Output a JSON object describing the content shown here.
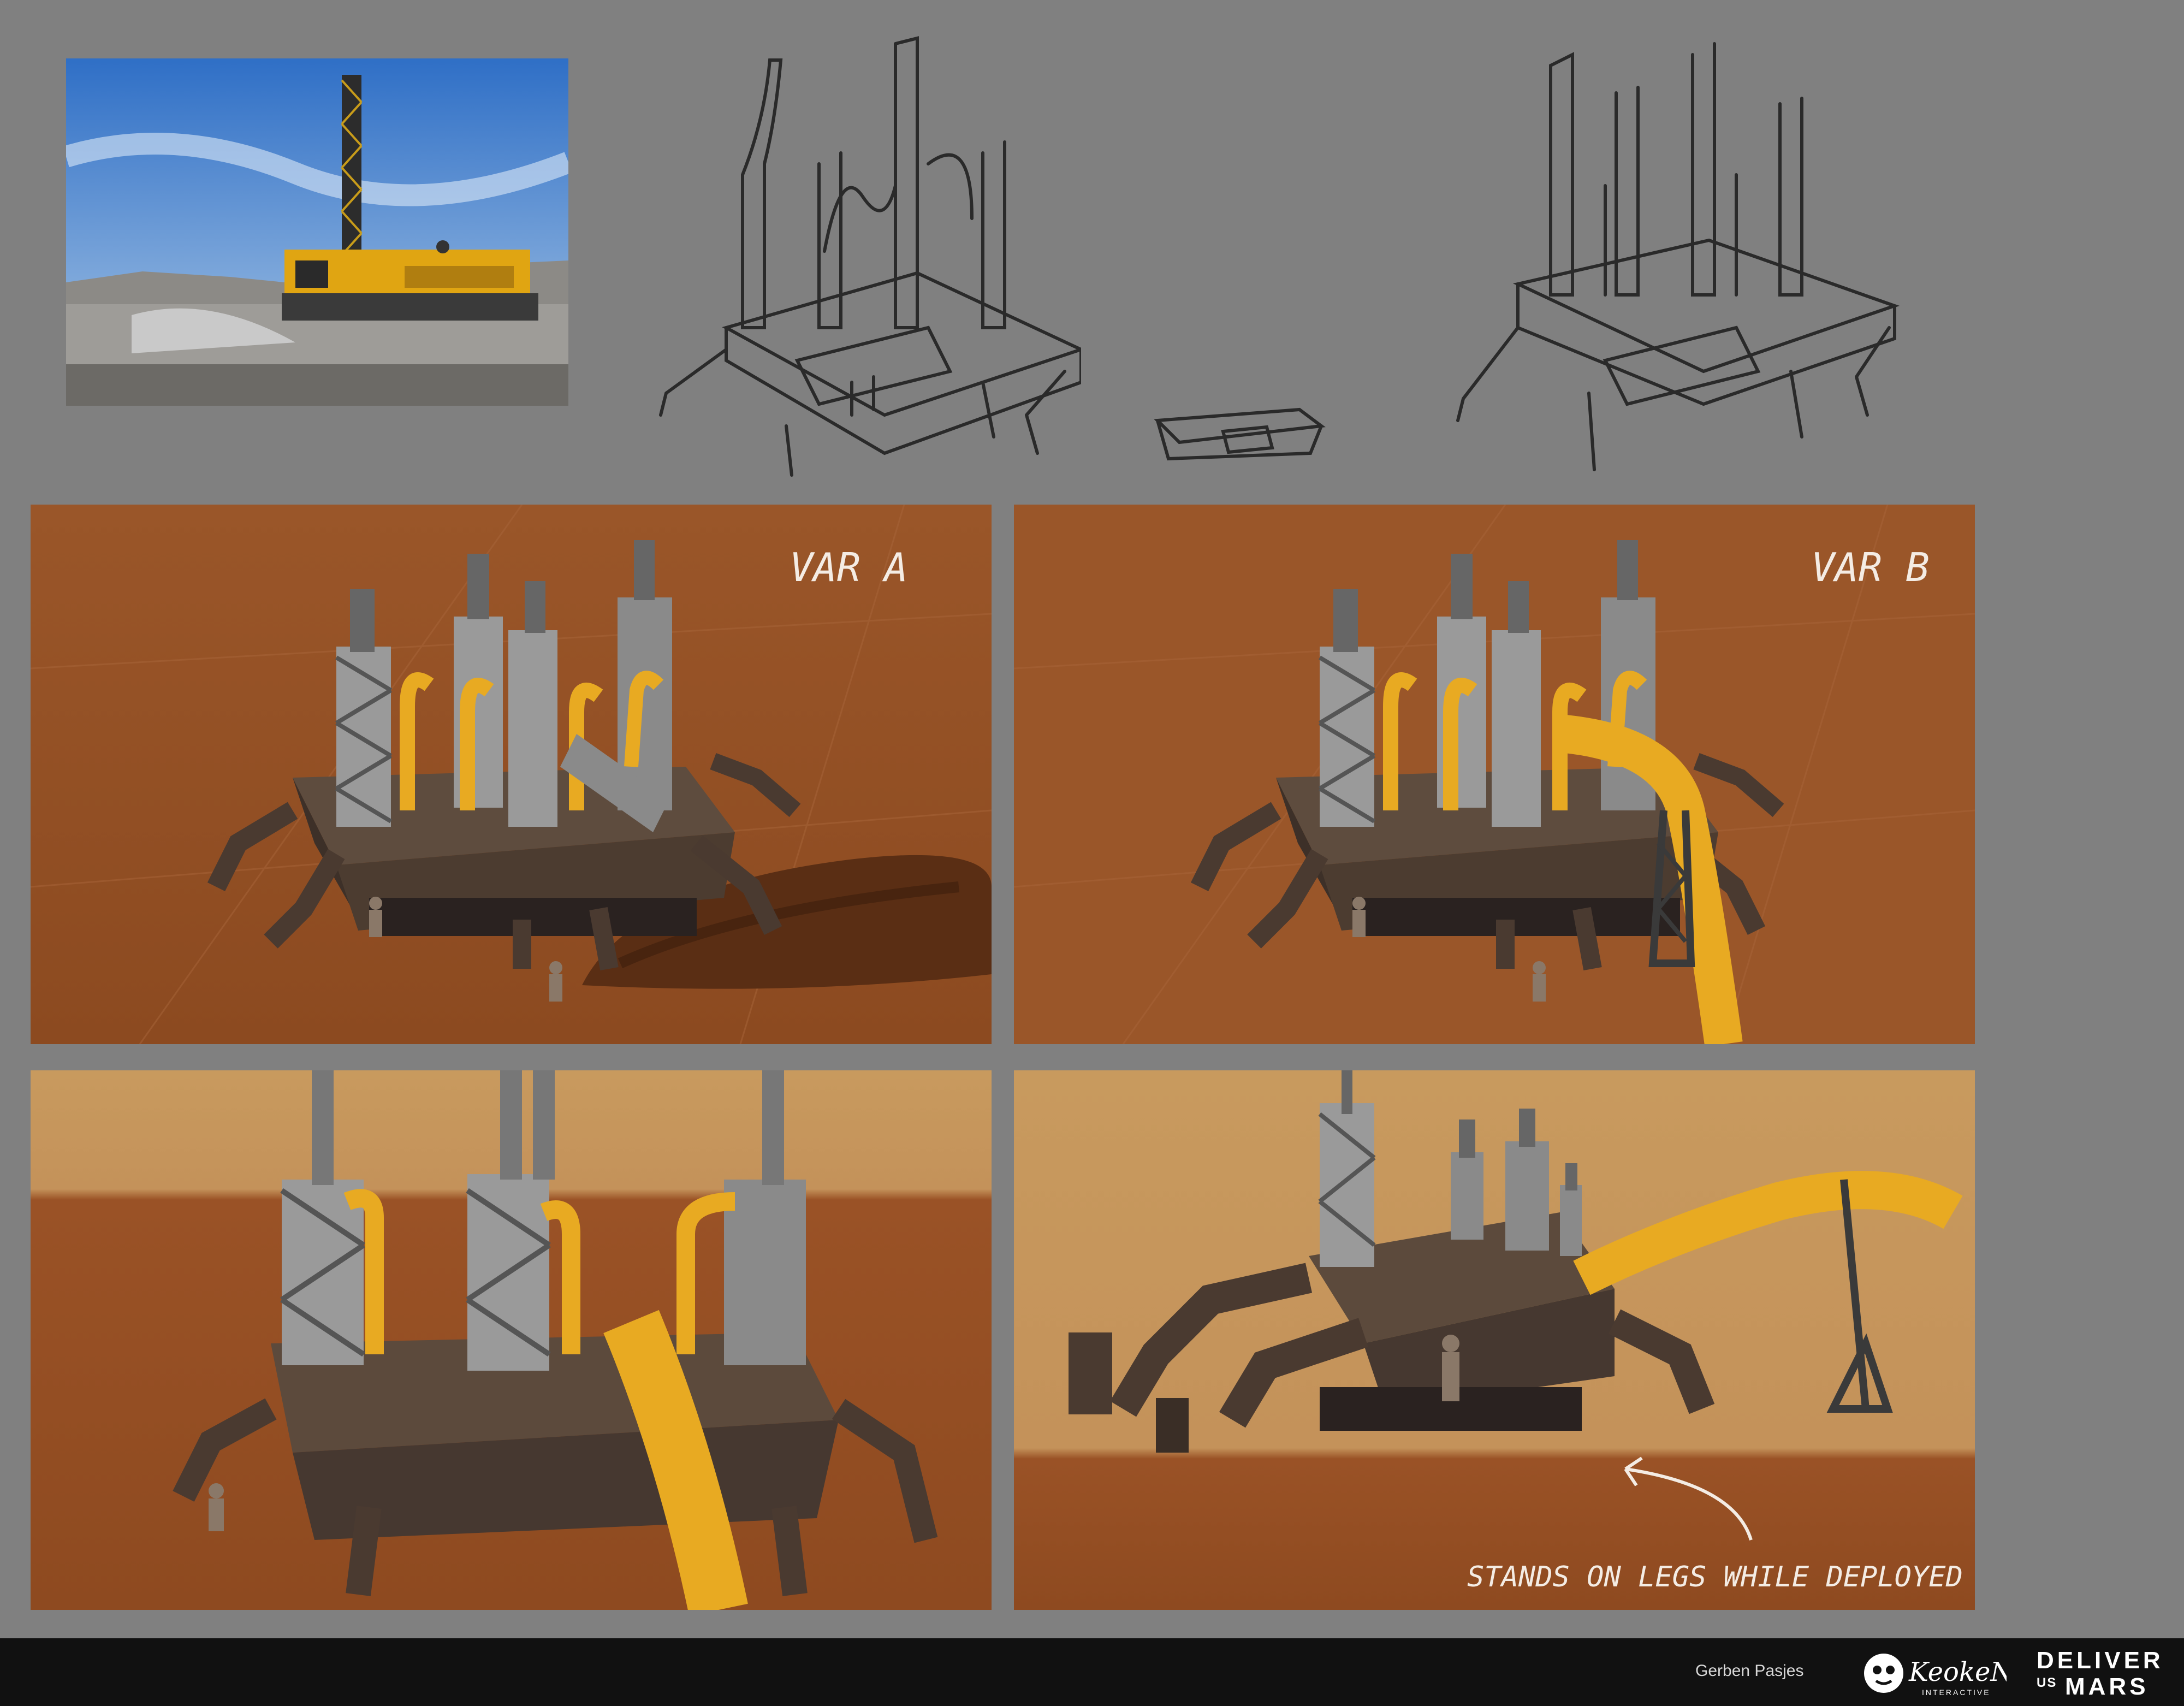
{
  "labels": {
    "var_a": "VAR A",
    "var_b": "VAR B",
    "note": "STANDS ON LEGS WHILE DEPLOYED"
  },
  "footer": {
    "credit": "Gerben Pasjes",
    "studio_logo": "KeokeN",
    "studio_sub": "INTERACTIVE",
    "game_logo_line1": "DELIVER",
    "game_logo_us": "US",
    "game_logo_mars": "MARS"
  },
  "colors": {
    "background": "#808080",
    "mars_ground": "#9a5226",
    "mars_sky": "#c89a5e",
    "hose_yellow": "#e8aa22",
    "footer": "#111111"
  }
}
